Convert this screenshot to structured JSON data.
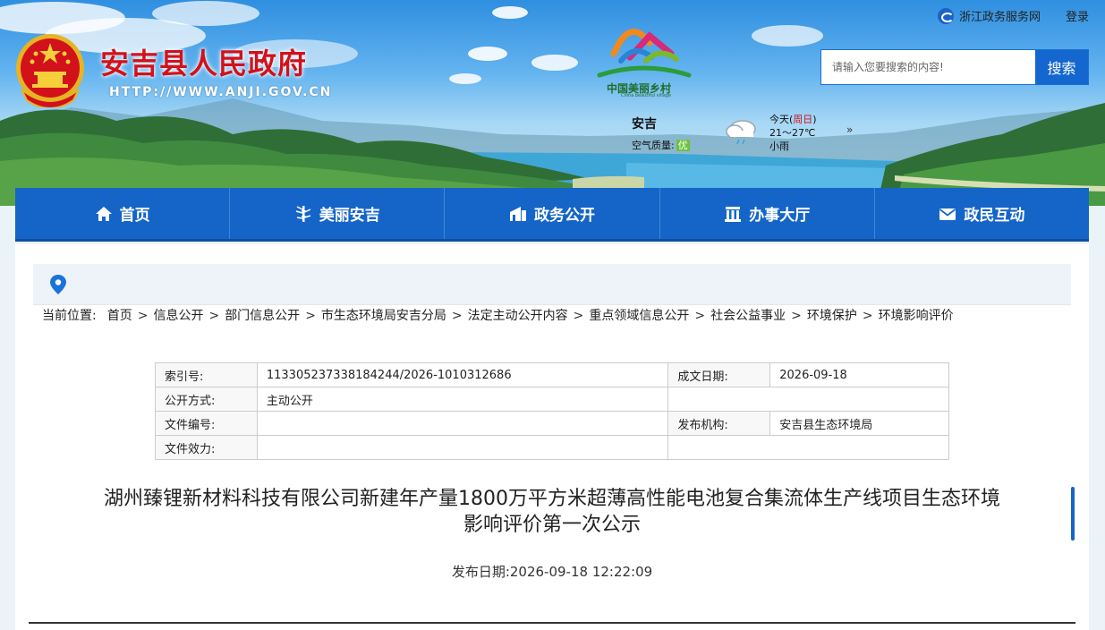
{
  "site": {
    "title": "安吉县人民政府",
    "url_prefix": "HTTP://WWW.",
    "url_domain": "ANJI",
    "url_suffix": ".GOV.CN"
  },
  "village_logo": {
    "text": "中国美丽乡村",
    "sub": "China beautiful village"
  },
  "top_links": {
    "service": "浙江政务服务网",
    "login": "登录"
  },
  "search": {
    "placeholder": "请输入您要搜索的内容!",
    "button": "搜索"
  },
  "weather": {
    "city": "安吉",
    "aqi_label": "空气质量:",
    "aqi_value": "优",
    "today": "今天(",
    "weekday": "周日",
    "today_close": ")",
    "temp": "21～27℃",
    "condition": "小雨",
    "more": "»"
  },
  "nav": [
    {
      "label": "首页",
      "icon": "home-icon"
    },
    {
      "label": "美丽安吉",
      "icon": "bamboo-icon"
    },
    {
      "label": "政务公开",
      "icon": "building-icon"
    },
    {
      "label": "办事大厅",
      "icon": "hall-icon"
    },
    {
      "label": "政民互动",
      "icon": "envelope-icon"
    }
  ],
  "breadcrumb": {
    "prefix": "当前位置:",
    "items": [
      "首页",
      "信息公开",
      "部门信息公开",
      "市生态环境局安吉分局",
      "法定主动公开内容",
      "重点领域信息公开",
      "社会公益事业",
      "环境保护",
      "环境影响评价"
    ]
  },
  "meta_table": {
    "rows": [
      {
        "k1": "索引号:",
        "v1": "113305237338184244/2026-1010312686",
        "k2": "成文日期:",
        "v2": "2026-09-18"
      },
      {
        "k1": "公开方式:",
        "v1": "主动公开",
        "k2": "",
        "v2": ""
      },
      {
        "k1": "文件编号:",
        "v1": "",
        "k2": "发布机构:",
        "v2": "安吉县生态环境局"
      },
      {
        "k1": "文件效力:",
        "v1": "",
        "k2": "",
        "v2": ""
      }
    ]
  },
  "document": {
    "title_line1": "湖州臻锂新材料科技有限公司新建年产量1800万平方米超薄高性能电池复合集流体生产线项目生态环境",
    "title_line2": "影响评价第一次公示",
    "pub_label": "发布日期:",
    "pub_date": "2026-09-18 12:22:09"
  },
  "colors": {
    "nav_blue": "#1565c8",
    "title_red": "#d2111b"
  }
}
